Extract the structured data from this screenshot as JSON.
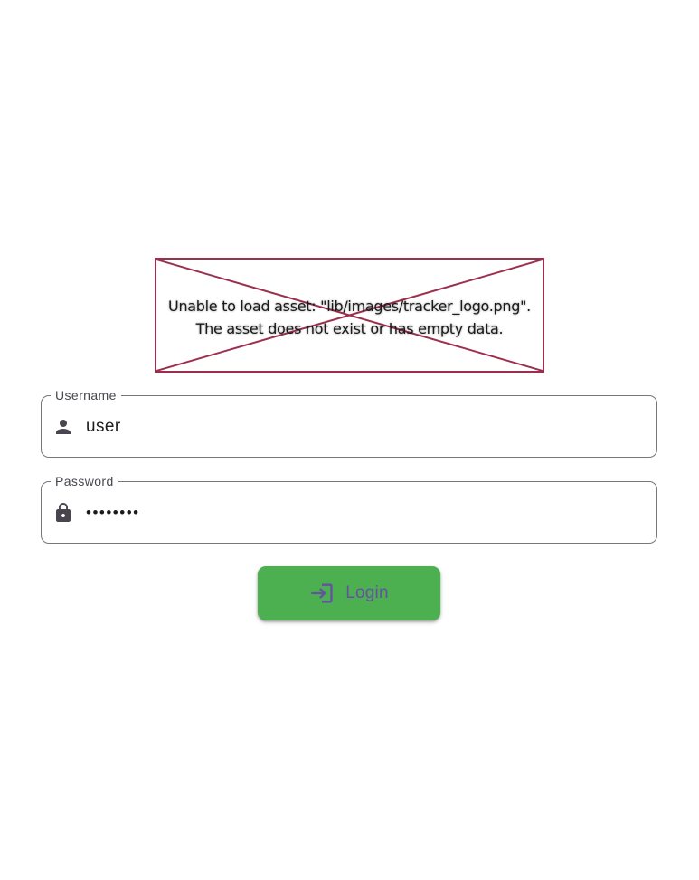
{
  "logo_error": {
    "line1": "Unable to load asset: \"lib/images/tracker_logo.png\".",
    "line2": "The asset does not exist or has empty data.",
    "border_color": "#9c2f4e"
  },
  "username": {
    "label": "Username",
    "value": "user",
    "icon": "person-icon"
  },
  "password": {
    "label": "Password",
    "value": "••••••••",
    "icon": "lock-icon"
  },
  "login_button": {
    "label": "Login",
    "icon": "login-icon",
    "background": "#4caf50",
    "text_color": "#6750a4"
  }
}
